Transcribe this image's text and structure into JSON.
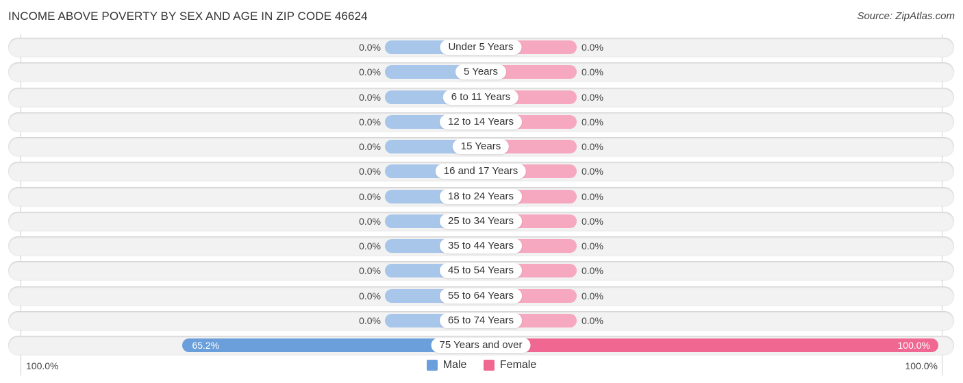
{
  "header": {
    "title": "INCOME ABOVE POVERTY BY SEX AND AGE IN ZIP CODE 46624",
    "source": "Source: ZipAtlas.com"
  },
  "colors": {
    "male": "#6a9fdc",
    "male_light": "#a8c6ea",
    "female": "#f06892",
    "female_light": "#f6a8c0",
    "row_bg": "#f2f2f2"
  },
  "chart_data": {
    "type": "bar",
    "orientation": "horizontal-diverging",
    "title": "INCOME ABOVE POVERTY BY SEX AND AGE IN ZIP CODE 46624",
    "categories": [
      "Under 5 Years",
      "5 Years",
      "6 to 11 Years",
      "12 to 14 Years",
      "15 Years",
      "16 and 17 Years",
      "18 to 24 Years",
      "25 to 34 Years",
      "35 to 44 Years",
      "45 to 54 Years",
      "55 to 64 Years",
      "65 to 74 Years",
      "75 Years and over"
    ],
    "series": [
      {
        "name": "Male",
        "values": [
          0,
          0,
          0,
          0,
          0,
          0,
          0,
          0,
          0,
          0,
          0,
          0,
          65.2
        ],
        "labels": [
          "0.0%",
          "0.0%",
          "0.0%",
          "0.0%",
          "0.0%",
          "0.0%",
          "0.0%",
          "0.0%",
          "0.0%",
          "0.0%",
          "0.0%",
          "0.0%",
          "65.2%"
        ]
      },
      {
        "name": "Female",
        "values": [
          0,
          0,
          0,
          0,
          0,
          0,
          0,
          0,
          0,
          0,
          0,
          0,
          100.0
        ],
        "labels": [
          "0.0%",
          "0.0%",
          "0.0%",
          "0.0%",
          "0.0%",
          "0.0%",
          "0.0%",
          "0.0%",
          "0.0%",
          "0.0%",
          "0.0%",
          "0.0%",
          "100.0%"
        ]
      }
    ],
    "xlim": [
      -100,
      100
    ],
    "axis_labels": {
      "left": "100.0%",
      "right": "100.0%"
    },
    "legend": {
      "position": "bottom-center",
      "entries": [
        "Male",
        "Female"
      ]
    },
    "grid": false
  }
}
